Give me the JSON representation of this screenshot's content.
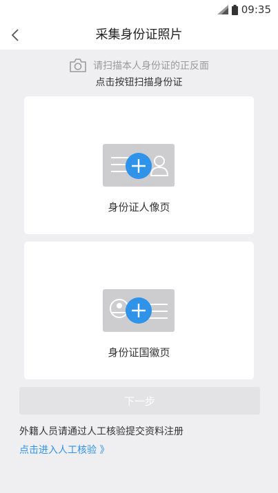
{
  "status_bar": {
    "time": "09:35",
    "signal_icon": "signal-icon",
    "battery_icon": "battery-icon"
  },
  "nav": {
    "back_icon": "chevron-left-icon",
    "title": "采集身份证照片"
  },
  "hint": {
    "camera_icon": "camera-icon",
    "text": "请扫描本人身份证的正反面",
    "sub_text": "点击按钮扫描身份证"
  },
  "cards": [
    {
      "label": "身份证人像页",
      "icon": "id-card-portrait-icon",
      "action_icon": "plus-icon"
    },
    {
      "label": "身份证国徽页",
      "icon": "id-card-emblem-icon",
      "action_icon": "plus-icon"
    }
  ],
  "next_button": {
    "label": "下一步",
    "enabled": false
  },
  "footer": {
    "note": "外籍人员请通过人工核验提交资料注册",
    "link": "点击进入人工核验 》"
  },
  "colors": {
    "background": "#efeff2",
    "accent": "#2f93ea",
    "card_illustration": "#cdcdd0",
    "button_disabled": "#e3e3e6"
  }
}
